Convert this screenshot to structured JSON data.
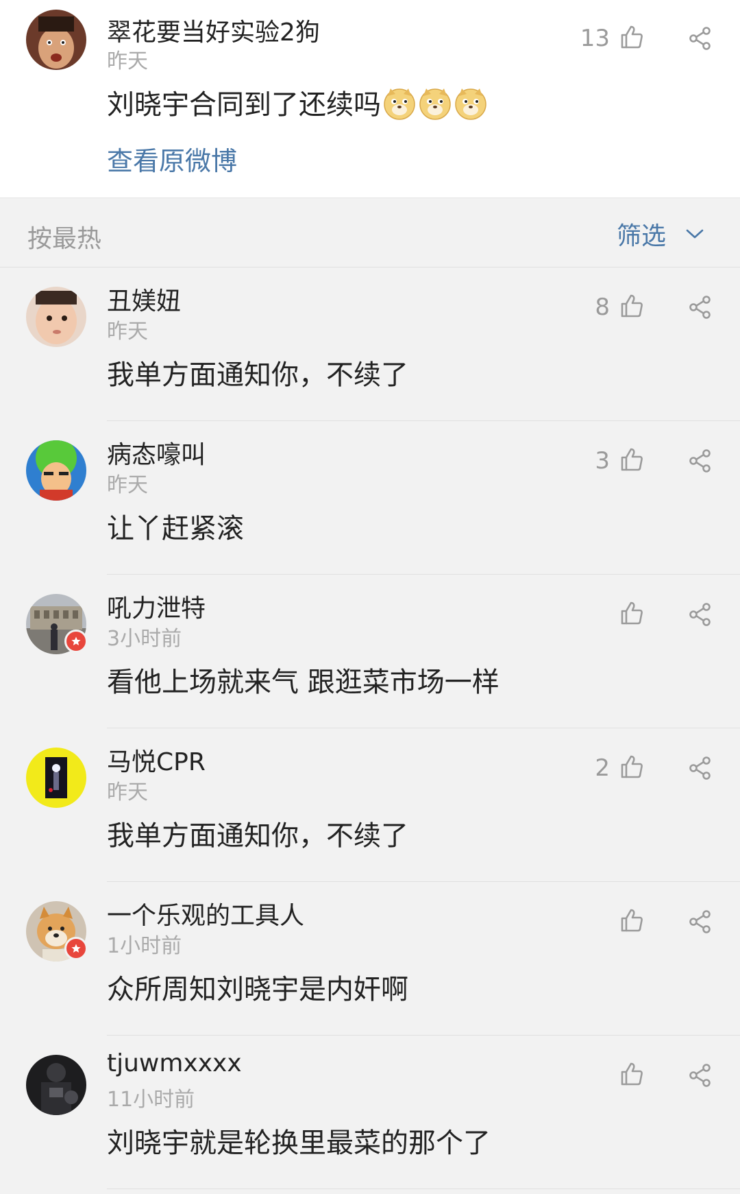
{
  "post": {
    "username": "翠花要当好实验2狗",
    "time": "昨天",
    "text": "刘晓宇合同到了还续吗",
    "emoji_count": 3,
    "emoji_icon": "doge-emoji-icon",
    "likes": "13",
    "view_origin": "查看原微博"
  },
  "sortbar": {
    "sort_label": "按最热",
    "filter_label": "筛选"
  },
  "comments": [
    {
      "username": "丑媄妞",
      "time": "昨天",
      "text": "我单方面通知你，不续了",
      "likes": "8",
      "verified": false,
      "avatar": "baby-photo"
    },
    {
      "username": "病态嚎叫",
      "time": "昨天",
      "text": "让丫赶紧滚",
      "likes": "3",
      "verified": false,
      "avatar": "cartoon-green-hair"
    },
    {
      "username": "吼力泄特",
      "time": "3小时前",
      "text": "看他上场就来气 跟逛菜市场一样",
      "likes": "",
      "verified": true,
      "avatar": "colosseum-photo"
    },
    {
      "username": "马悦CPR",
      "time": "昨天",
      "text": "我单方面通知你，不续了",
      "likes": "2",
      "verified": false,
      "avatar": "yellow-stage-photo"
    },
    {
      "username": "一个乐观的工具人",
      "time": "1小时前",
      "text": "众所周知刘晓宇是内奸啊",
      "likes": "",
      "verified": true,
      "avatar": "shiba-dog-photo"
    },
    {
      "username": "tjuwmxxxx",
      "time": "11小时前",
      "text": "刘晓宇就是轮换里最菜的那个了",
      "likes": "",
      "verified": false,
      "avatar": "basketball-player-photo"
    }
  ],
  "colors": {
    "link_blue": "#4a78a8",
    "muted_gray": "#9a9a9a",
    "background": "#f2f2f2",
    "verified_red": "#e8463c"
  }
}
